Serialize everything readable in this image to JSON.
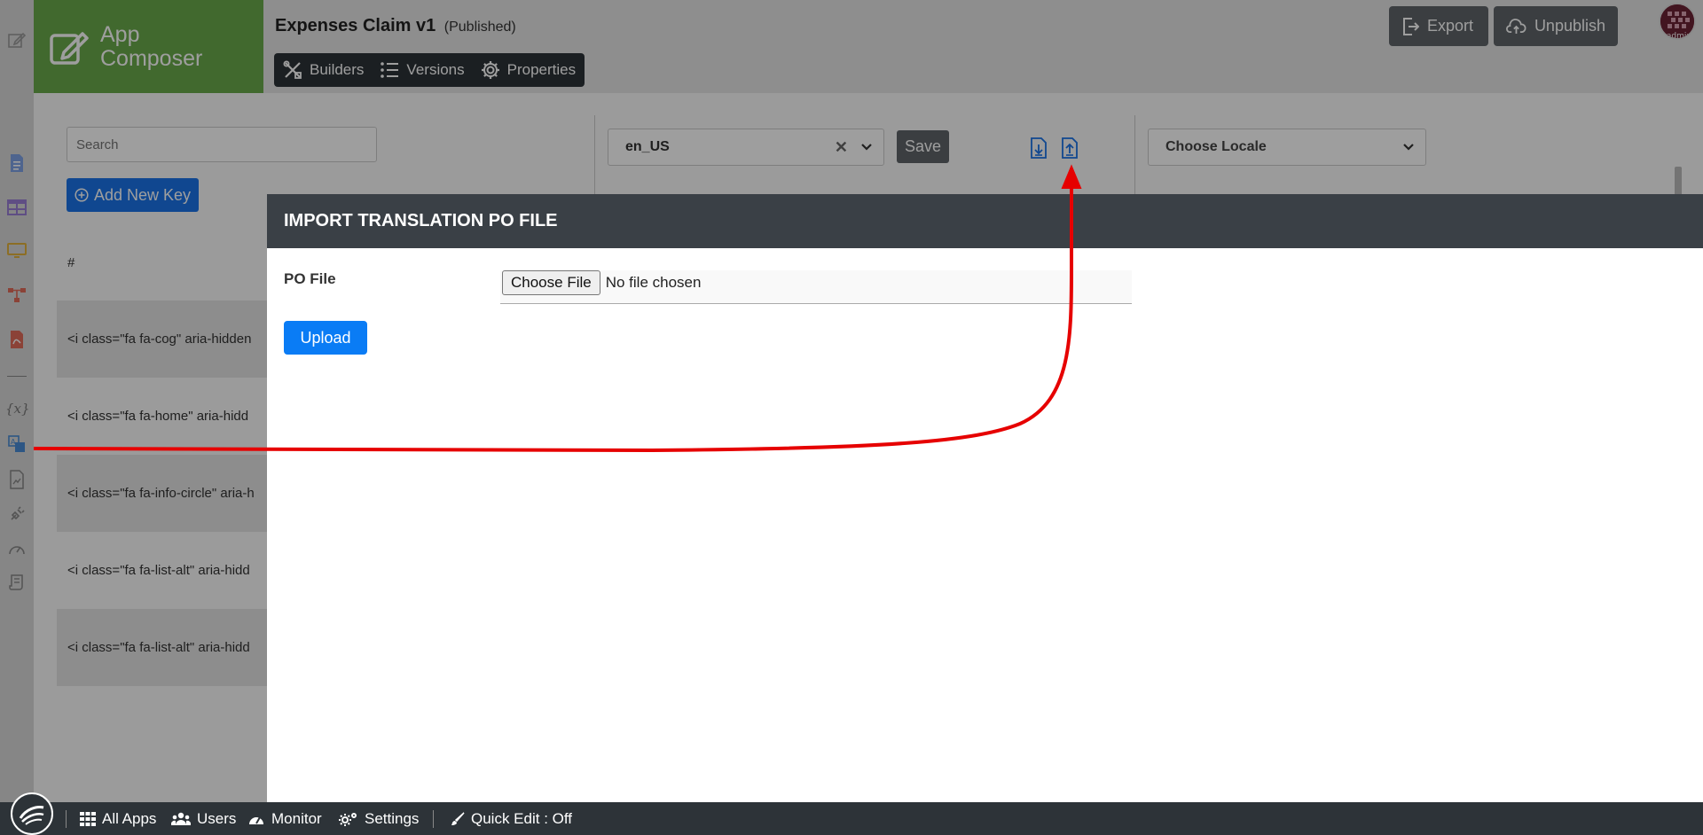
{
  "header": {
    "brand_line1": "App",
    "brand_line2": "Composer",
    "app_name": "Expenses Claim v1",
    "app_status": "(Published)",
    "tabs": [
      {
        "label": "Builders"
      },
      {
        "label": "Versions"
      },
      {
        "label": "Properties"
      }
    ],
    "export_label": "Export",
    "unpublish_label": "Unpublish",
    "avatar_text": "admin"
  },
  "sidebar": {
    "variables_label": "{x}",
    "icons": [
      "form-icon",
      "datalist-icon",
      "userview-icon",
      "process-icon",
      "pdf-icon",
      "variables-icon",
      "translation-icon",
      "report-icon",
      "plugin-icon",
      "performance-icon",
      "logs-icon"
    ]
  },
  "content": {
    "search_placeholder": "Search",
    "add_key_label": "Add New Key",
    "column_hash": "#",
    "rows": [
      "<i class=\"fa fa-cog\" aria-hidden",
      "<i class=\"fa fa-home\" aria-hidd",
      "<i class=\"fa fa-info-circle\" aria-h",
      "<i class=\"fa fa-list-alt\" aria-hidd",
      "<i class=\"fa fa-list-alt\" aria-hidd"
    ],
    "locale_value": "en_US",
    "save_label": "Save",
    "choose_locale_label": "Choose Locale"
  },
  "modal": {
    "title": "IMPORT TRANSLATION PO FILE",
    "po_file_label": "PO File",
    "choose_file_label": "Choose File",
    "no_file_text": "No file chosen",
    "upload_label": "Upload"
  },
  "bottom_bar": {
    "all_apps": "All Apps",
    "users": "Users",
    "monitor": "Monitor",
    "settings": "Settings",
    "quick_edit": "Quick Edit : Off"
  },
  "colors": {
    "brand": "#6aaa4b",
    "primary": "#1a73e8",
    "dark": "#2d3338",
    "annotation": "#e60000"
  }
}
